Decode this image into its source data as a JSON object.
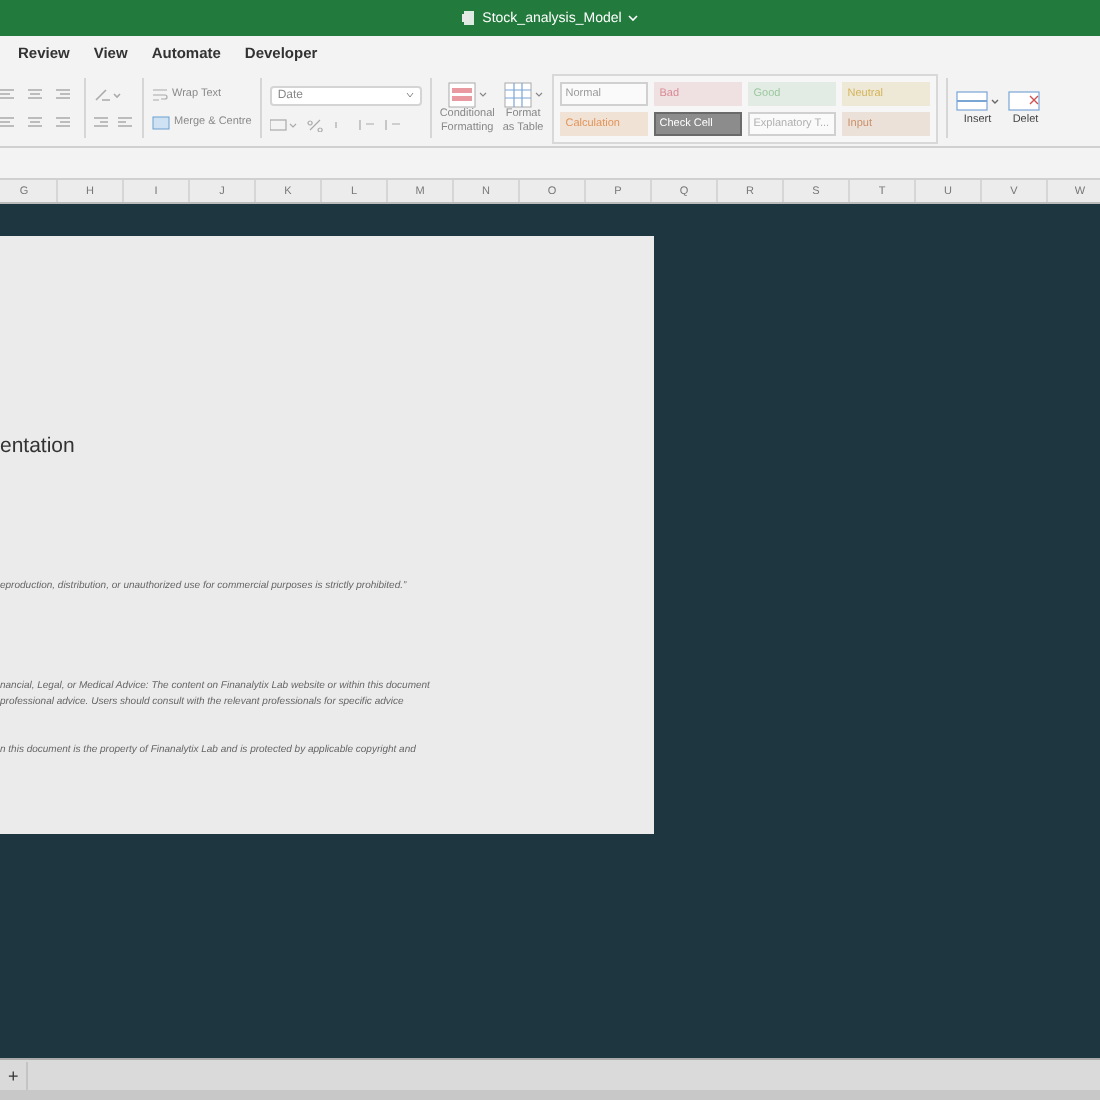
{
  "window": {
    "title": "Stock_analysis_Model"
  },
  "menu_tabs": [
    {
      "label": "Review",
      "selected": false
    },
    {
      "label": "View",
      "selected": false
    },
    {
      "label": "Automate",
      "selected": false
    },
    {
      "label": "Developer",
      "selected": false
    }
  ],
  "ribbon": {
    "wrap_text": "Wrap Text",
    "merge": "Merge & Centre",
    "number_format": "Date",
    "conditional_formatting": [
      "Conditional",
      "Formatting"
    ],
    "format_as_table": [
      "Format",
      "as Table"
    ],
    "cell_styles": [
      {
        "label": "Normal",
        "kind": "plain",
        "color": "#9a9a9a"
      },
      {
        "label": "Bad",
        "kind": "tinted",
        "color": "#d98c96"
      },
      {
        "label": "Good",
        "kind": "tinted",
        "color": "#9cc89e"
      },
      {
        "label": "Neutral",
        "kind": "tinted",
        "color": "#d4b45a"
      },
      {
        "label": "Calculation",
        "kind": "tinted",
        "color": "#e0955a"
      },
      {
        "label": "Check Cell",
        "kind": "filled",
        "color": "#8c8c8c"
      },
      {
        "label": "Explanatory T...",
        "kind": "plain",
        "color": "#b0b0b0"
      },
      {
        "label": "Input",
        "kind": "tinted",
        "color": "#c9906a"
      }
    ],
    "insert": "Insert",
    "delete": "Delet"
  },
  "columns": [
    "G",
    "H",
    "I",
    "J",
    "K",
    "L",
    "M",
    "N",
    "O",
    "P",
    "Q",
    "R",
    "S",
    "T",
    "U",
    "V",
    "W"
  ],
  "document": {
    "heading": "entation",
    "paragraphs": [
      "eproduction, distribution, or unauthorized use for commercial purposes is strictly prohibited.”",
      "nancial, Legal, or Medical Advice: The content on Finanalytix Lab website or within this document",
      "professional advice. Users should consult with the relevant professionals for specific advice",
      "n this document is the property of Finanalytix Lab and is protected by applicable copyright and"
    ]
  },
  "sheet_bar": {
    "add": "+"
  }
}
